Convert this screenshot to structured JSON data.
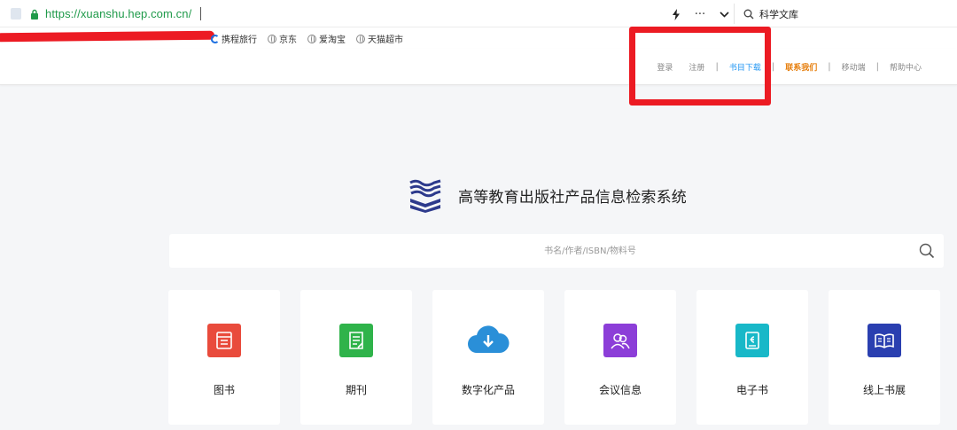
{
  "browser": {
    "url": "https://xuanshu.hep.com.cn/",
    "search_engine_label": "科学文库",
    "menu_glyph": "···"
  },
  "bookmarks": [
    {
      "label": "携程旅行",
      "icon": "ctrip-icon"
    },
    {
      "label": "京东",
      "icon": "globe-icon"
    },
    {
      "label": "爱淘宝",
      "icon": "globe-icon"
    },
    {
      "label": "天猫超市",
      "icon": "globe-icon"
    }
  ],
  "topnav": {
    "login": "登录",
    "register": "注册",
    "catalog": "书目下载",
    "contact": "联系我们",
    "mobile": "移动端",
    "help": "帮助中心",
    "separator": "|"
  },
  "site": {
    "title": "高等教育出版社产品信息检索系统"
  },
  "search": {
    "placeholder": "书名/作者/ISBN/物料号"
  },
  "categories": [
    {
      "label": "图书",
      "icon": "book-icon",
      "color": "#e94b3c"
    },
    {
      "label": "期刊",
      "icon": "journal-icon",
      "color": "#2fb34a"
    },
    {
      "label": "数字化产品",
      "icon": "cloud-download-icon",
      "color": "#2a8fd8"
    },
    {
      "label": "会议信息",
      "icon": "meeting-icon",
      "color": "#8c3ed8"
    },
    {
      "label": "电子书",
      "icon": "ebook-icon",
      "color": "#18b8c8"
    },
    {
      "label": "线上书展",
      "icon": "online-bookfair-icon",
      "color": "#2a3fb0"
    }
  ],
  "colors": {
    "url_green": "#1f9a4a",
    "highlight_red": "#ec1b23",
    "link_blue": "#2196f3",
    "contact_orange": "#e67e0c",
    "logo_navy": "#2d3a8c"
  }
}
